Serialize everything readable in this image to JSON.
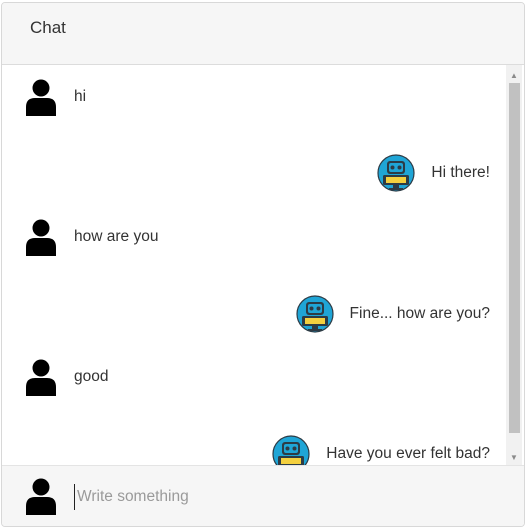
{
  "header": {
    "title": "Chat"
  },
  "messages": [
    {
      "sender": "user",
      "text": "hi",
      "avatar_icon": "user-icon"
    },
    {
      "sender": "bot",
      "text": "Hi there!",
      "avatar_icon": "robot-icon"
    },
    {
      "sender": "user",
      "text": "how are you",
      "avatar_icon": "user-icon"
    },
    {
      "sender": "bot",
      "text": "Fine... how are you?",
      "avatar_icon": "robot-icon"
    },
    {
      "sender": "user",
      "text": "good",
      "avatar_icon": "user-icon"
    },
    {
      "sender": "bot",
      "text": "Have you ever felt bad?",
      "avatar_icon": "robot-icon"
    }
  ],
  "composer": {
    "placeholder": "Write something",
    "value": "",
    "avatar_icon": "user-icon"
  },
  "colors": {
    "header_bg": "#f6f6f6",
    "robot_body": "#1fa5d6",
    "robot_dark": "#2d3b45",
    "robot_screen": "#f4d03f"
  }
}
